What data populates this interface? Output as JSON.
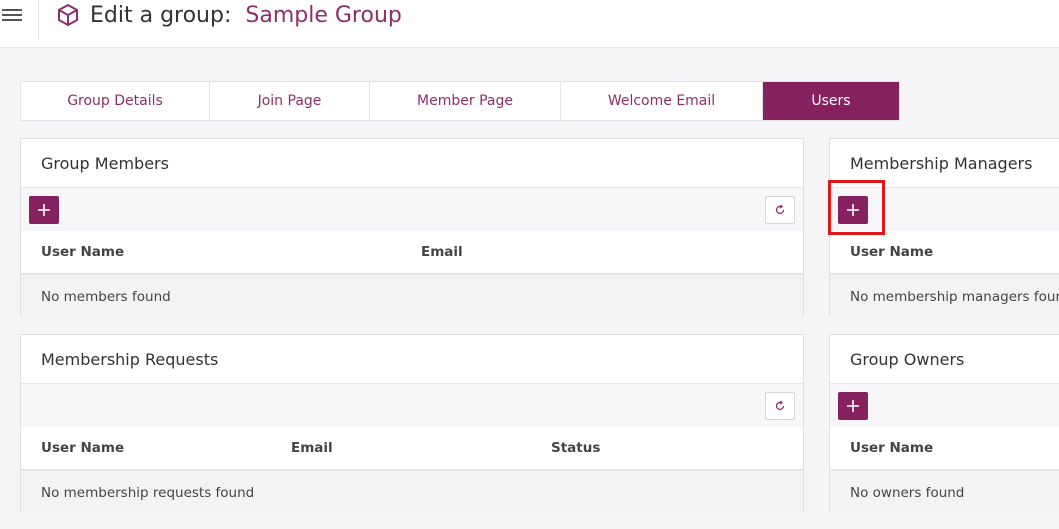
{
  "header": {
    "title_prefix": "Edit a group:",
    "group_name": "Sample Group",
    "icons": {
      "menu": "hamburger-menu-icon",
      "group": "cube-icon"
    }
  },
  "tabs": [
    {
      "label": "Group Details",
      "active": false
    },
    {
      "label": "Join Page",
      "active": false
    },
    {
      "label": "Member Page",
      "active": false
    },
    {
      "label": "Welcome Email",
      "active": false
    },
    {
      "label": "Users",
      "active": true
    }
  ],
  "panels": {
    "group_members": {
      "title": "Group Members",
      "columns": [
        "User Name",
        "Email"
      ],
      "empty_text": "No members found"
    },
    "membership_requests": {
      "title": "Membership Requests",
      "columns": [
        "User Name",
        "Email",
        "Status"
      ],
      "empty_text": "No membership requests found"
    },
    "membership_managers": {
      "title": "Membership Managers",
      "columns": [
        "User Name"
      ],
      "empty_text": "No membership managers found"
    },
    "group_owners": {
      "title": "Group Owners",
      "columns": [
        "User Name"
      ],
      "empty_text": "No owners found"
    }
  },
  "colors": {
    "brand": "#85215f",
    "brand_text": "#8c2f6c",
    "highlight": "#e01818"
  }
}
